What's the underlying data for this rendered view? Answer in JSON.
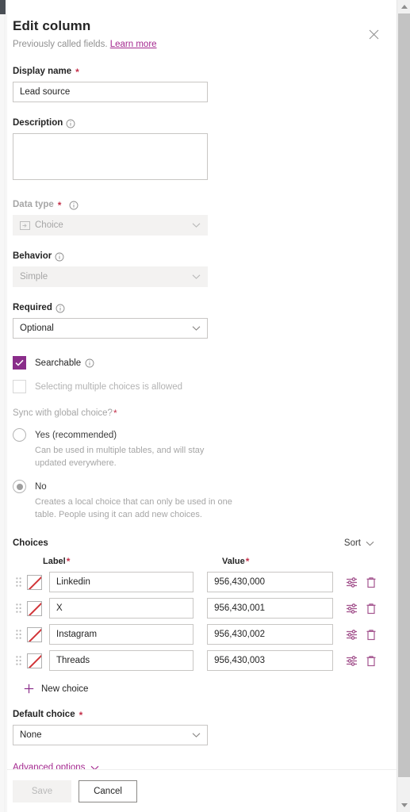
{
  "header": {
    "title": "Edit column",
    "subtitle_prefix": "Previously called fields.",
    "learn_more": "Learn more",
    "close_icon": "close-icon"
  },
  "fields": {
    "display_name": {
      "label": "Display name",
      "required_marker": "*",
      "value": "Lead source",
      "placeholder": ""
    },
    "description": {
      "label": "Description",
      "value": "",
      "placeholder": ""
    },
    "data_type": {
      "label": "Data type",
      "required_marker": "*",
      "value": "Choice",
      "icon": "choice-icon",
      "disabled": true
    },
    "behavior": {
      "label": "Behavior",
      "value": "Simple",
      "disabled": true
    },
    "required": {
      "label": "Required",
      "value": "Optional",
      "disabled": false
    }
  },
  "checkboxes": {
    "searchable": {
      "label": "Searchable",
      "checked": true,
      "disabled": false
    },
    "multi_select": {
      "label": "Selecting multiple choices is allowed",
      "checked": false,
      "disabled": true
    }
  },
  "sync_global": {
    "heading": "Sync with global choice?",
    "required_marker": "*",
    "options": [
      {
        "label": "Yes (recommended)",
        "description": "Can be used in multiple tables, and will stay updated everywhere.",
        "selected": false
      },
      {
        "label": "No",
        "description": "Creates a local choice that can only be used in one table. People using it can add new choices.",
        "selected": true
      }
    ]
  },
  "choices": {
    "section_title": "Choices",
    "sort_label": "Sort",
    "columns": {
      "label": "Label",
      "label_required": "*",
      "value": "Value",
      "value_required": "*"
    },
    "rows": [
      {
        "label": "Linkedin",
        "value": "956,430,000",
        "color_swatch": "no-color-swatch"
      },
      {
        "label": "X",
        "value": "956,430,001",
        "color_swatch": "no-color-swatch"
      },
      {
        "label": "Instagram",
        "value": "956,430,002",
        "color_swatch": "no-color-swatch"
      },
      {
        "label": "Threads",
        "value": "956,430,003",
        "color_swatch": "no-color-swatch"
      }
    ],
    "row_actions": {
      "settings_icon": "sliders-icon",
      "delete_icon": "trash-icon"
    },
    "new_choice_label": "New choice"
  },
  "default_choice": {
    "label": "Default choice",
    "required_marker": "*",
    "value": "None"
  },
  "advanced_options": {
    "label": "Advanced options"
  },
  "footer": {
    "save_label": "Save",
    "save_disabled": true,
    "cancel_label": "Cancel"
  },
  "colors": {
    "accent": "#8a2d8a",
    "link": "#a4288f",
    "required": "#c4314b",
    "row_action": "#a4558f",
    "swatch_strike": "#d13438"
  }
}
